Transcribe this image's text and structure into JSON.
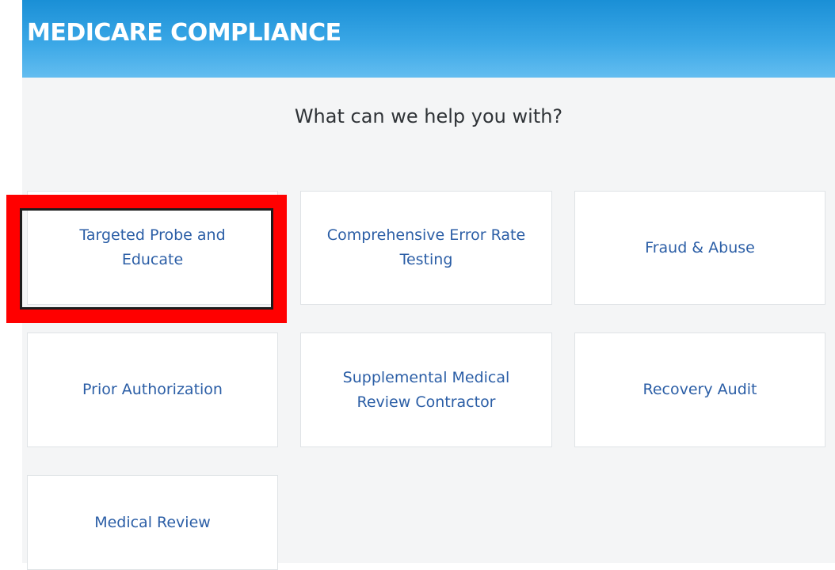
{
  "header": {
    "title": "MEDICARE COMPLIANCE"
  },
  "prompt": "What can we help you with?",
  "cards": [
    {
      "label": "Targeted Probe and Educate"
    },
    {
      "label": "Comprehensive Error Rate Testing"
    },
    {
      "label": "Fraud & Abuse"
    },
    {
      "label": "Prior Authorization"
    },
    {
      "label": "Supplemental Medical Review Contractor"
    },
    {
      "label": "Recovery Audit"
    },
    {
      "label": "Medical Review"
    }
  ],
  "annotation": {
    "highlighted_card": "Targeted Probe and Educate",
    "highlight_color": "#ff0000"
  },
  "colors": {
    "header_gradient_top": "#1a8fd6",
    "header_gradient_bottom": "#63bdf0",
    "link_text": "#2b5ea6",
    "background": "#f4f5f6"
  }
}
